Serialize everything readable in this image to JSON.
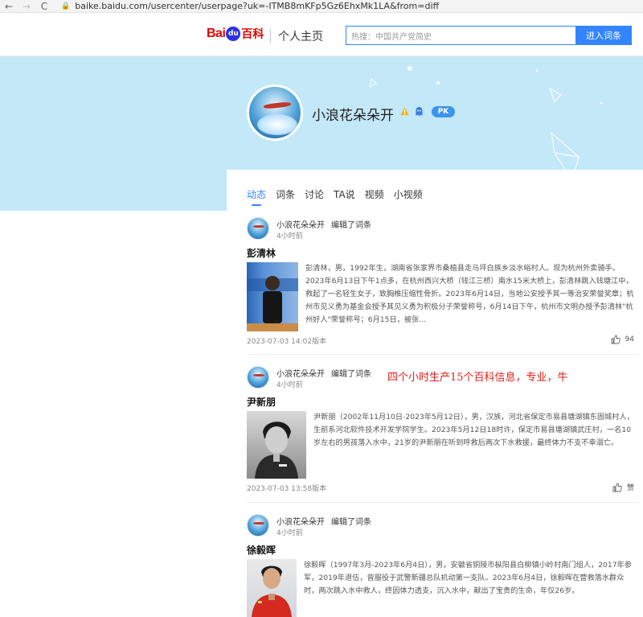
{
  "browser": {
    "back": "←",
    "forward": "→",
    "reload": "C",
    "url": "baike.baidu.com/usercenter/userpage?uk=-ITMB8mKFp5Gz6EhxMk1LA&from=diff"
  },
  "header": {
    "logo_bai": "Bai",
    "logo_du": "du",
    "logo_baike": "百科",
    "page_name": "个人主页",
    "search_placeholder": "热搜：中国共产党简史",
    "search_button": "进入词条"
  },
  "profile": {
    "username": "小浪花朵朵开",
    "pk_label": "PK"
  },
  "tabs": [
    {
      "label": "动态",
      "active": true
    },
    {
      "label": "词条",
      "active": false
    },
    {
      "label": "讨论",
      "active": false
    },
    {
      "label": "TA说",
      "active": false
    },
    {
      "label": "视频",
      "active": false
    },
    {
      "label": "小视频",
      "active": false
    }
  ],
  "feed": [
    {
      "author": "小浪花朵朵开",
      "action": "编辑了词条",
      "time": "4小时前",
      "title": "彭清林",
      "text": "彭清林，男，1992年生，湖南省张家界市桑植县走马坪白族乡淡水峪村人。现为杭州外卖骑手。2023年6月13日下午1点多，在杭州西兴大桥（钱江三桥）南水15米大桥上，彭清林跳入钱塘江中，救起了一名轻生女子，致胸椎压缩性骨折。2023年6月14日，当地公安授予其一等治安荣誉奖章；杭州市见义勇为基金会授予其见义勇为积极分子荣誉称号，6月14日下午，杭州市文明办授予彭清林\"杭州好人\"荣誉称号；6月15日，被张...",
      "version": "2023-07-03 14:02版本",
      "likes": "94"
    },
    {
      "author": "小浪花朵朵开",
      "action": "编辑了词条",
      "time": "4小时前",
      "title": "尹新朋",
      "text": "尹新朋（2002年11月10日-2023年5月12日），男，汉族，河北省保定市易县塘湖镇东固城村人，生前系河北软件技术开发学院学生。2023年5月12日18时许，保定市易县塘湖镇武庄村，一名10岁左右的男孩落入水中，21岁的尹新朋在听到呼救后两次下水救援，最终体力不支不幸溺亡。",
      "version": "2023-07-03 13:58版本",
      "likes": "赞"
    },
    {
      "author": "小浪花朵朵开",
      "action": "编辑了词条",
      "time": "4小时前",
      "title": "徐毅晖",
      "text": "徐毅晖（1997年3月-2023年6月4日），男，安徽省铜陵市枞阳县白柳镇小岭村南门组人，2017年参军，2019年退伍，曾服役于武警新疆总队机动第一支队。2023年6月4日，徐毅晖在营救落水群众时，两次跳入水中救人，终因体力透支，沉入水中，献出了宝贵的生命，年仅26岁。"
    }
  ],
  "annotation": "四个小时生产15个百科信息，专业，牛",
  "colors": {
    "accent": "#3385ff",
    "banner": "#c3e8f8",
    "annotation": "#e0201b"
  }
}
